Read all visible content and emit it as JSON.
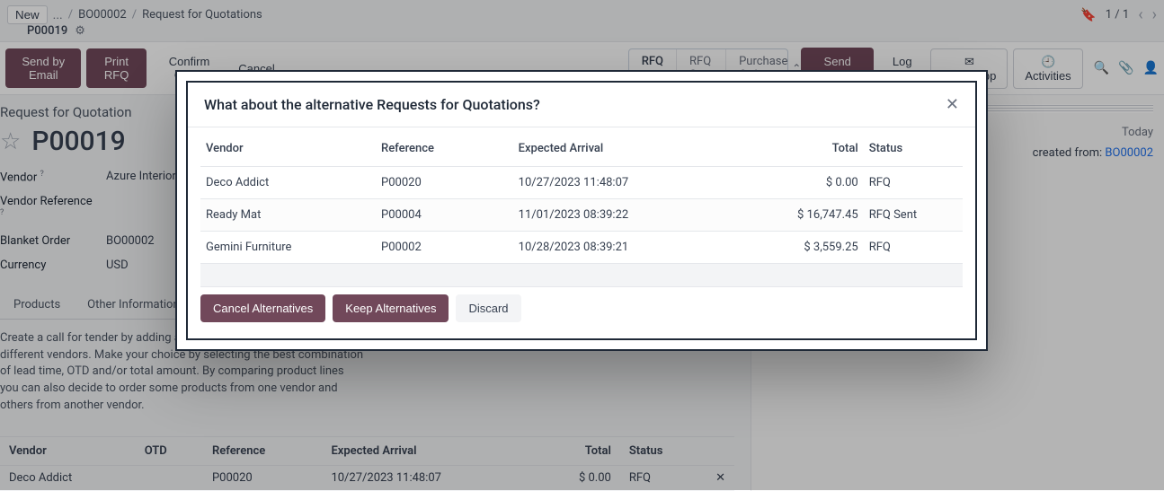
{
  "breadcrumb": {
    "ellipsis": "...",
    "parent": "BO00002",
    "section": "Request for Quotations",
    "current": "P00019",
    "new": "New"
  },
  "pager": {
    "label": "1 / 1"
  },
  "toolbar": {
    "send_email": "Send by Email",
    "print_rfq": "Print RFQ",
    "confirm": "Confirm Order",
    "cancel": "Cancel"
  },
  "states": {
    "rfq": "RFQ",
    "rfq_sent": "RFQ Sent",
    "po": "Purchase Order"
  },
  "chatter": {
    "send": "Send message",
    "log": "Log note",
    "whatsapp": "WhatsApp",
    "activities": "Activities",
    "today": "Today",
    "msg_prefix": "created from: ",
    "msg_link": "BO00002"
  },
  "form": {
    "doc_type": "Request for Quotation",
    "doc_name": "P00019",
    "vendor_label": "Vendor",
    "vendor_val": "Azure Interior – U",
    "vendor_ref_label": "Vendor Reference",
    "blanket_label": "Blanket Order",
    "blanket_val": "BO00002",
    "currency_label": "Currency",
    "currency_val": "USD"
  },
  "tabs": {
    "products": "Products",
    "other": "Other Information"
  },
  "tender_text": "Create a call for tender by adding alternative requests for quotation to different vendors. Make your choice by selecting the best combination of lead time, OTD and/or total amount. By comparing product lines you can also decide to order some products from one vendor and others from another vendor.",
  "bottom_table": {
    "headers": {
      "vendor": "Vendor",
      "otd": "OTD",
      "ref": "Reference",
      "arrival": "Expected Arrival",
      "total": "Total",
      "status": "Status"
    },
    "rows": [
      {
        "vendor": "Deco Addict",
        "otd": "",
        "ref": "P00020",
        "arrival": "10/27/2023 11:48:07",
        "total": "$ 0.00",
        "status": "RFQ"
      }
    ]
  },
  "modal": {
    "title": "What about the alternative Requests for Quotations?",
    "headers": {
      "vendor": "Vendor",
      "ref": "Reference",
      "arrival": "Expected Arrival",
      "total": "Total",
      "status": "Status"
    },
    "rows": [
      {
        "vendor": "Deco Addict",
        "ref": "P00020",
        "arrival": "10/27/2023 11:48:07",
        "total": "$ 0.00",
        "status": "RFQ"
      },
      {
        "vendor": "Ready Mat",
        "ref": "P00004",
        "arrival": "11/01/2023 08:39:22",
        "total": "$ 16,747.45",
        "status": "RFQ Sent"
      },
      {
        "vendor": "Gemini Furniture",
        "ref": "P00002",
        "arrival": "10/28/2023 08:39:21",
        "total": "$ 3,559.25",
        "status": "RFQ"
      }
    ],
    "cancel_alt": "Cancel Alternatives",
    "keep_alt": "Keep Alternatives",
    "discard": "Discard"
  }
}
